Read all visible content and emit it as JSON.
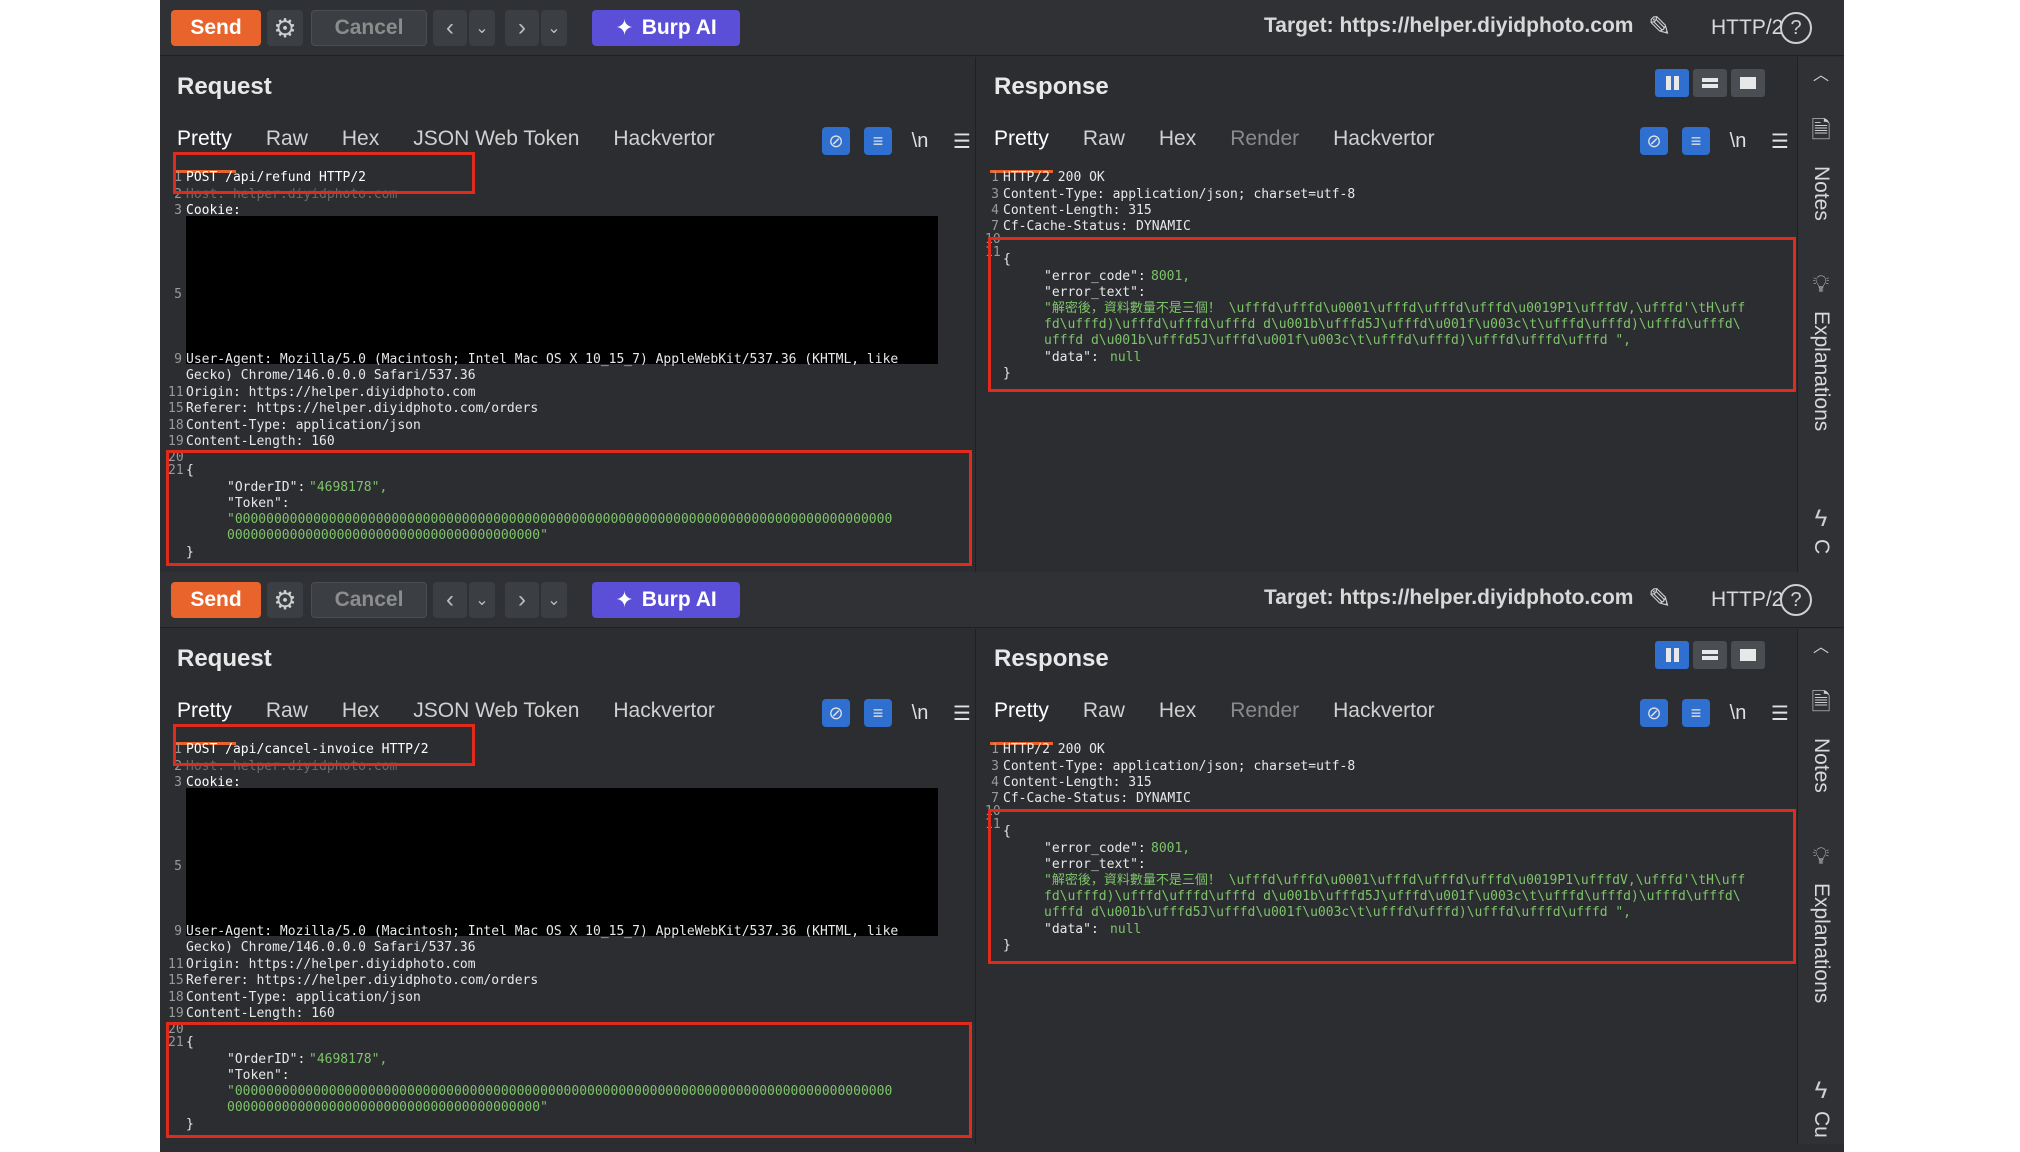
{
  "panels": [
    {
      "toolbar": {
        "send": "Send",
        "cancel": "Cancel",
        "burp_ai": "Burp AI",
        "target": "Target: https://helper.diyidphoto.com",
        "protocol": "HTTP/2"
      },
      "request": {
        "title": "Request",
        "tabs": [
          "Pretty",
          "Raw",
          "Hex",
          "JSON Web Token",
          "Hackvertor"
        ],
        "line_numbers": [
          "1",
          "2",
          "3",
          "5",
          "9",
          "",
          "11",
          "15",
          "18",
          "19",
          "20",
          "21"
        ],
        "lines": {
          "l1": "POST /api/refund HTTP/2",
          "l2": "Host: helper.diyidphoto.com",
          "l3": "Cookie:",
          "l9a": "User-Agent: Mozilla/5.0 (Macintosh; Intel Mac OS X 10_15_7) AppleWebKit/537.36 (KHTML, like",
          "l9b": "Gecko) Chrome/146.0.0.0 Safari/537.36",
          "l11": "Origin: https://helper.diyidphoto.com",
          "l15": "Referer: https://helper.diyidphoto.com/orders",
          "l18": "Content-Type: application/json",
          "l19": "Content-Length: 160",
          "b1": "{",
          "b2k": "\"OrderID\":",
          "b2v": "\"4698178\",",
          "b3k": "\"Token\":",
          "b4": "\"000000000000000000000000000000000000000000000000000000000000000000000000000000000000",
          "b5": "0000000000000000000000000000000000000000\"",
          "b6": "}"
        }
      },
      "response": {
        "title": "Response",
        "tabs": [
          "Pretty",
          "Raw",
          "Hex",
          "Render",
          "Hackvertor"
        ],
        "line_numbers": [
          "1",
          "3",
          "4",
          "7",
          "10",
          "11"
        ],
        "lines": {
          "l1": "HTTP/2 200 OK",
          "l3": "Content-Type: application/json; charset=utf-8",
          "l4": "Content-Length: 315",
          "l7": "Cf-Cache-Status: DYNAMIC",
          "b1": "{",
          "b2k": "\"error_code\":",
          "b2v": "8001,",
          "b3k": "\"error_text\":",
          "b4": "\"解密後，資料數量不是三個！ \\ufffd\\ufffd\\u0001\\ufffd\\ufffd\\ufffd\\u0019P1\\ufffdV,\\ufffd'\\tH\\uff",
          "b5": "fd\\ufffd)\\ufffd\\ufffd\\ufffd d\\u001b\\ufffd5J\\ufffd\\u001f\\u003c\\t\\ufffd\\ufffd)\\ufffd\\ufffd\\",
          "b6": "ufffd d\\u001b\\ufffd5J\\ufffd\\u001f\\u003c\\t\\ufffd\\ufffd)\\ufffd\\ufffd\\ufffd \",",
          "b7k": "\"data\":",
          "b7v": "null",
          "b8": "}"
        }
      }
    },
    {
      "toolbar": {
        "send": "Send",
        "cancel": "Cancel",
        "burp_ai": "Burp AI",
        "target": "Target: https://helper.diyidphoto.com",
        "protocol": "HTTP/2"
      },
      "request": {
        "title": "Request",
        "tabs": [
          "Pretty",
          "Raw",
          "Hex",
          "JSON Web Token",
          "Hackvertor"
        ],
        "line_numbers": [
          "1",
          "2",
          "3",
          "5",
          "9",
          "",
          "11",
          "15",
          "18",
          "19",
          "20",
          "21"
        ],
        "lines": {
          "l1": "POST /api/cancel-invoice HTTP/2",
          "l2": "Host: helper.diyidphoto.com",
          "l3": "Cookie:",
          "l9a": "User-Agent: Mozilla/5.0 (Macintosh; Intel Mac OS X 10_15_7) AppleWebKit/537.36 (KHTML, like",
          "l9b": "Gecko) Chrome/146.0.0.0 Safari/537.36",
          "l11": "Origin: https://helper.diyidphoto.com",
          "l15": "Referer: https://helper.diyidphoto.com/orders",
          "l18": "Content-Type: application/json",
          "l19": "Content-Length: 160",
          "b1": "{",
          "b2k": "\"OrderID\":",
          "b2v": "\"4698178\",",
          "b3k": "\"Token\":",
          "b4": "\"000000000000000000000000000000000000000000000000000000000000000000000000000000000000",
          "b5": "0000000000000000000000000000000000000000\"",
          "b6": "}"
        }
      },
      "response": {
        "title": "Response",
        "tabs": [
          "Pretty",
          "Raw",
          "Hex",
          "Render",
          "Hackvertor"
        ],
        "line_numbers": [
          "1",
          "3",
          "4",
          "7",
          "10",
          "11"
        ],
        "lines": {
          "l1": "HTTP/2 200 OK",
          "l3": "Content-Type: application/json; charset=utf-8",
          "l4": "Content-Length: 315",
          "l7": "Cf-Cache-Status: DYNAMIC",
          "b1": "{",
          "b2k": "\"error_code\":",
          "b2v": "8001,",
          "b3k": "\"error_text\":",
          "b4": "\"解密後，資料數量不是三個！ \\ufffd\\ufffd\\u0001\\ufffd\\ufffd\\ufffd\\u0019P1\\ufffdV,\\ufffd'\\tH\\uff",
          "b5": "fd\\ufffd)\\ufffd\\ufffd\\ufffd d\\u001b\\ufffd5J\\ufffd\\u001f\\u003c\\t\\ufffd\\ufffd)\\ufffd\\ufffd\\",
          "b6": "ufffd d\\u001b\\ufffd5J\\ufffd\\u001f\\u003c\\t\\ufffd\\ufffd)\\ufffd\\ufffd\\ufffd \",",
          "b7k": "\"data\":",
          "b7v": "null",
          "b8": "}"
        }
      }
    }
  ],
  "sidebar": {
    "notes": "Notes",
    "explanations": "Explanations",
    "third": "C",
    "third_b": "Cu"
  },
  "icons": {
    "settings": "gear-icon",
    "ai": "sparkle-icon",
    "edit": "pencil-icon",
    "help": "question-icon",
    "notes": "document-icon",
    "explanations": "lightbulb-icon",
    "third": "lightning-icon"
  },
  "colors": {
    "accent_send": "#e8642c",
    "burp_ai": "#5a4fd6",
    "highlight": "#e02a1b",
    "string": "#7ec46a",
    "toggle": "#2f6fd0"
  }
}
